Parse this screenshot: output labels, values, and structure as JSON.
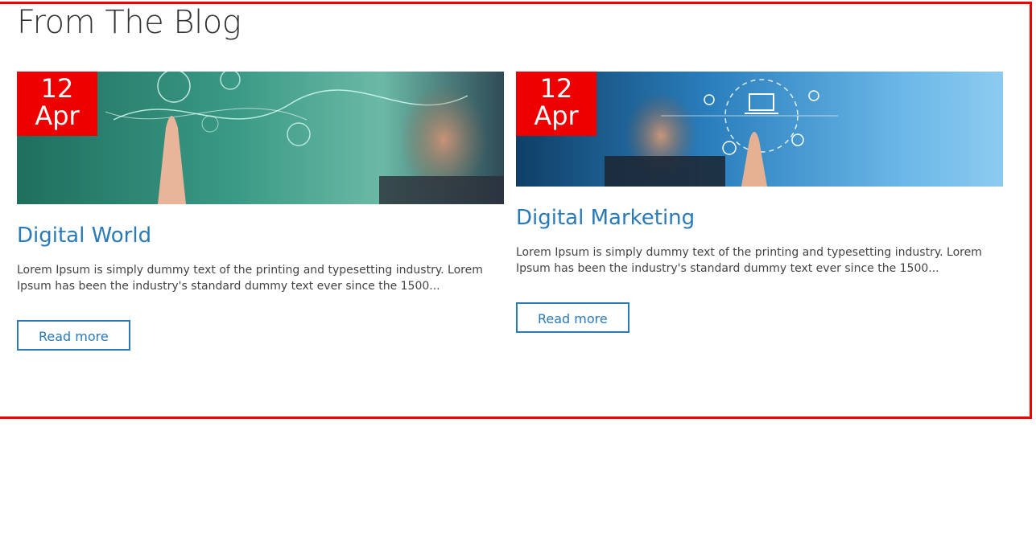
{
  "section": {
    "title": "From The Blog"
  },
  "colors": {
    "accent": "#ee0000",
    "link": "#2a7ab8",
    "text": "#444444"
  },
  "posts": [
    {
      "day": "12",
      "month": "Apr",
      "title": "Digital World",
      "excerpt": "Lorem Ipsum is simply dummy text of the printing and typesetting industry. Lorem Ipsum has been the industry's standard dummy text ever since the 1500...",
      "button_label": "Read more"
    },
    {
      "day": "12",
      "month": "Apr",
      "title": "Digital Marketing",
      "excerpt": "Lorem Ipsum is simply dummy text of the printing and typesetting industry. Lorem Ipsum has been the industry's standard dummy text ever since the 1500...",
      "button_label": "Read more"
    }
  ]
}
